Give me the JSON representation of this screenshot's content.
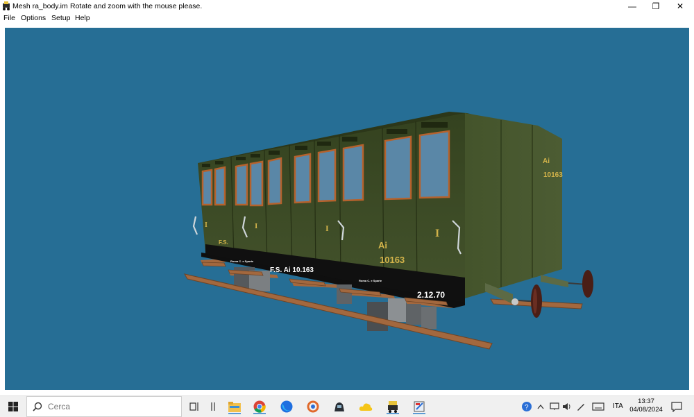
{
  "window": {
    "title": "Mesh ra_body.im",
    "hint": "Rotate and zoom with the mouse please.",
    "buttons": {
      "minimize": "—",
      "restore": "❐",
      "close": "✕"
    }
  },
  "menu": [
    "File",
    "Options",
    "Setup",
    "Help"
  ],
  "viewport": {
    "background": "#266e95",
    "model_texts": {
      "end_class": "Ai",
      "end_number": "10163",
      "side_class": "Ai",
      "side_number": "10163",
      "compartment_mark": "I",
      "owner_mark": "F.S.",
      "frame_marking": "F.S. Ai 10.163",
      "frame_date": "2.12.70"
    }
  },
  "taskbar": {
    "search_placeholder": "Cerca",
    "language": "ITA",
    "time": "13:37",
    "date": "04/08/2024"
  },
  "colors": {
    "body_green": "#3b4a26",
    "window_frame": "#b5622d",
    "glass": "#5b88a8",
    "frame_black": "#101010",
    "lettering": "#d2b34a",
    "planks": "#a2673d"
  }
}
